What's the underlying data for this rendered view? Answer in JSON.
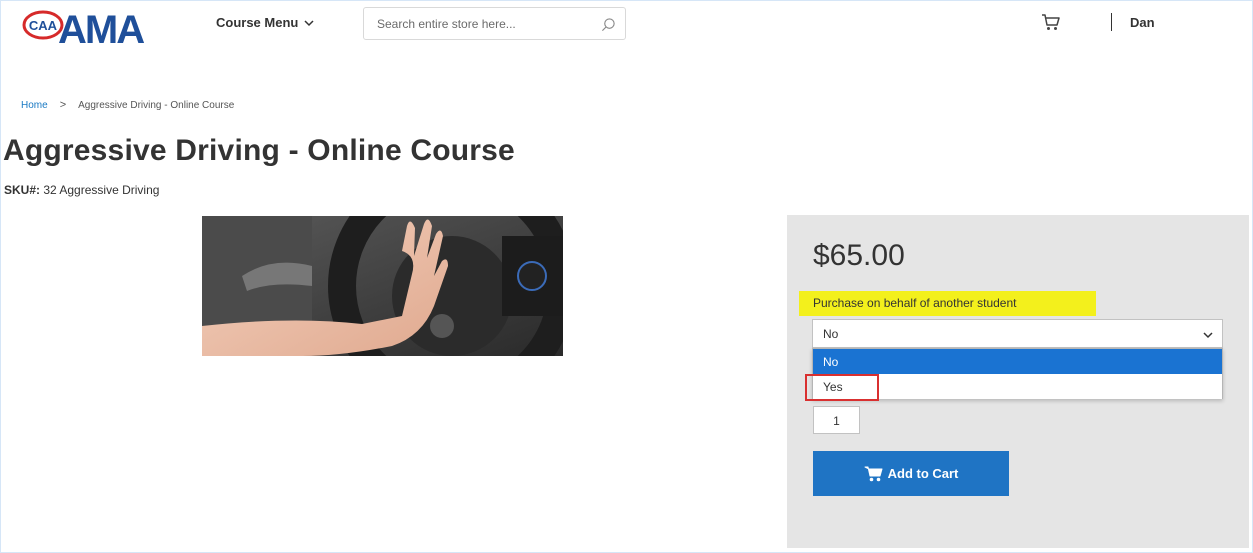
{
  "header": {
    "logo": {
      "text_small": "CAA",
      "text_large": "AMA"
    },
    "course_menu_label": "Course Menu",
    "search_placeholder": "Search entire store here...",
    "user_name": "Dan"
  },
  "breadcrumb": {
    "home": "Home",
    "separator": ">",
    "current": "Aggressive Driving - Online Course"
  },
  "product": {
    "title": "Aggressive Driving - Online Course",
    "sku_label": "SKU#:",
    "sku_value": "32 Aggressive Driving",
    "image_subject": "hand-on-steering-wheel-photo",
    "price": "$65.00",
    "option_label": "Purchase on behalf of another student",
    "option_selected": "No",
    "option_choices": [
      "No",
      "Yes"
    ],
    "quantity": "1",
    "add_to_cart_label": "Add to Cart"
  },
  "colors": {
    "brand_blue": "#1f74c4",
    "highlight_yellow": "#f3f01c",
    "annotation_red": "#d93030",
    "selected_option": "#1a73d2",
    "panel_bg": "#e5e5e5"
  }
}
